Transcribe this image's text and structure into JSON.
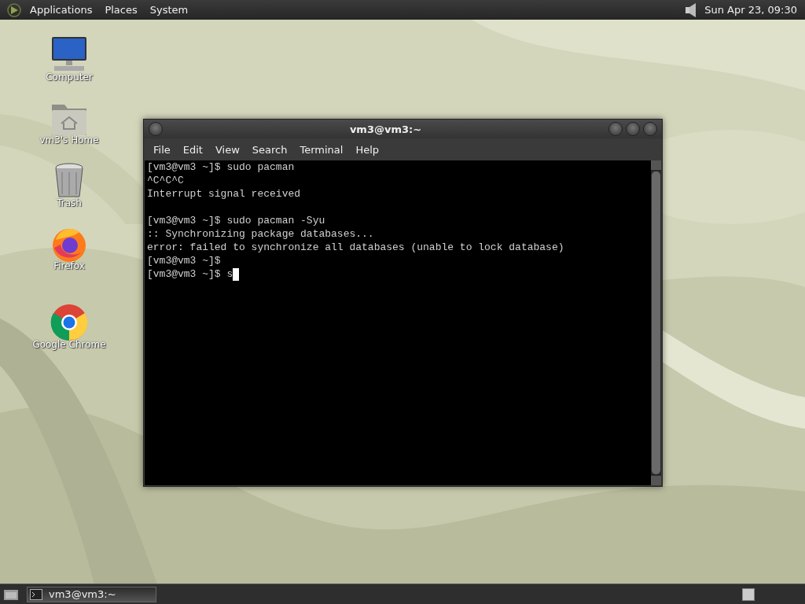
{
  "top_panel": {
    "menus": [
      {
        "label": "Applications"
      },
      {
        "label": "Places"
      },
      {
        "label": "System"
      }
    ],
    "clock": "Sun Apr 23, 09:30"
  },
  "desktop": {
    "icons": [
      {
        "kind": "computer",
        "label": "Computer"
      },
      {
        "kind": "home",
        "label": "vm3's Home"
      },
      {
        "kind": "trash",
        "label": "Trash"
      },
      {
        "kind": "firefox",
        "label": "Firefox"
      },
      {
        "kind": "chrome",
        "label": "Google Chrome"
      }
    ]
  },
  "terminal_window": {
    "title": "vm3@vm3:~",
    "menu": [
      {
        "label": "File"
      },
      {
        "label": "Edit"
      },
      {
        "label": "View"
      },
      {
        "label": "Search"
      },
      {
        "label": "Terminal"
      },
      {
        "label": "Help"
      }
    ],
    "output_blocks": [
      {
        "lines": [
          "[vm3@vm3 ~]$ sudo pacman",
          "^C^C^C",
          "Interrupt signal received"
        ]
      },
      {
        "lines": [
          "[vm3@vm3 ~]$ sudo pacman -Syu",
          ":: Synchronizing package databases...",
          "error: failed to synchronize all databases (unable to lock database)",
          "[vm3@vm3 ~]$",
          "[vm3@vm3 ~]$ s"
        ]
      }
    ]
  },
  "bottom_panel": {
    "tasks": [
      {
        "label": "vm3@vm3:~",
        "selected": true
      }
    ]
  }
}
